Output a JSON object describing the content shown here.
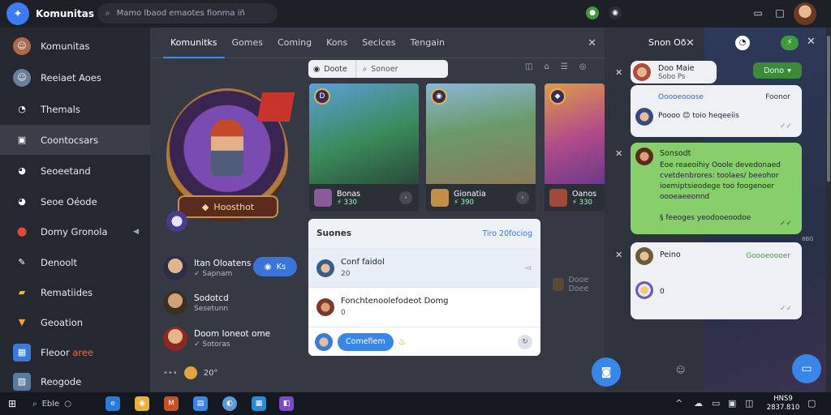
{
  "titlebar": {
    "app_name": "Komunitas",
    "search_placeholder": "Mamo lbaod emaotes fionma iñ",
    "icons": [
      "app-logo-icon",
      "search-icon",
      "notification-icon",
      "discord-icon",
      "minimize-icon",
      "maximize-icon",
      "close-icon"
    ]
  },
  "sidebar": {
    "items": [
      {
        "label": "Komunitas",
        "icon": "avatar-icon"
      },
      {
        "label": "Reeiaet Aoes",
        "icon": "avatar-icon"
      },
      {
        "label": "Themals",
        "icon": "chat-icon"
      },
      {
        "label": "Coontocsars",
        "icon": "bag-icon"
      },
      {
        "label": "Seoeetand",
        "icon": "chat-icon"
      },
      {
        "label": "Seoe Oéode",
        "icon": "chat-icon"
      },
      {
        "label": "Domy Gronola",
        "icon": "map-pin-icon"
      },
      {
        "label": "Denoolt",
        "icon": "edit-icon"
      },
      {
        "label": "Rematiides",
        "icon": "folder-icon"
      },
      {
        "label": "Geoation",
        "icon": "filter-icon"
      },
      {
        "label": "Fleoor",
        "accent": "aree",
        "icon": "calendar-icon"
      },
      {
        "label": "Reogode",
        "icon": "image-icon"
      }
    ]
  },
  "tabs": {
    "items": [
      "Komunitks",
      "Gomes",
      "Coming",
      "Kons",
      "Secices",
      "Tengain"
    ]
  },
  "hero": {
    "badge_label": "Hoosthot"
  },
  "friends": [
    {
      "name": "Itan Oloatens",
      "sub": "✓ Sapnam"
    },
    {
      "name": "Sodotcd",
      "sub": "Sesetunn"
    },
    {
      "name": "Doom Ioneot ome",
      "sub": "✓ Sotoras"
    }
  ],
  "join_pill": {
    "label": "Ks"
  },
  "coins": {
    "value": "20°"
  },
  "filter": {
    "button_label": "Doote",
    "search_label": "Sonoer"
  },
  "cards": [
    {
      "name": "Bonas",
      "count": "⚡ 330"
    },
    {
      "name": "Gionatia",
      "count": "⚡ 390"
    },
    {
      "name": "Oanos",
      "count": "⚡ 330"
    }
  ],
  "scores": {
    "title": "Suones",
    "link": "Tiro 20fociog",
    "rows": [
      {
        "title": "Conf faidol",
        "sub": "20"
      },
      {
        "title": "Fonchtenoolefodeot Domg",
        "sub": "0"
      }
    ],
    "compose_label": "Comefiem"
  },
  "trade_tag": {
    "label": "Dooe Doee"
  },
  "chat": {
    "title": "Snon Oð",
    "status_label": "Dono",
    "bubbles": [
      {
        "name": "Doo Maie",
        "sub": "Sobo Ps"
      },
      {
        "name": "Ooooeooose",
        "right": "Foonor",
        "text": "Poooo 😊 toio heqeeiis"
      },
      {
        "name": "Sonsodt",
        "text": "Eoe reaeoihiy Ooole devedonaed\ncvetdenbrores: toolaes/ beeohor\nioemiptsieodege too foogenoer\noooeaeeonnd\n\n§ feeoges yeodooeoodoe"
      },
      {
        "name": "Peino",
        "sub": "Goooeoooer",
        "text": "0"
      }
    ],
    "meta": "8BG"
  },
  "taskbar": {
    "search_label": "Eble",
    "clock_time": "HNS9",
    "clock_date": "2837.810"
  },
  "colors": {
    "accent": "#3a86e8",
    "green_bubble": "#86cf6a",
    "sidebar_bg": "#252831",
    "main_bg": "#353943"
  }
}
